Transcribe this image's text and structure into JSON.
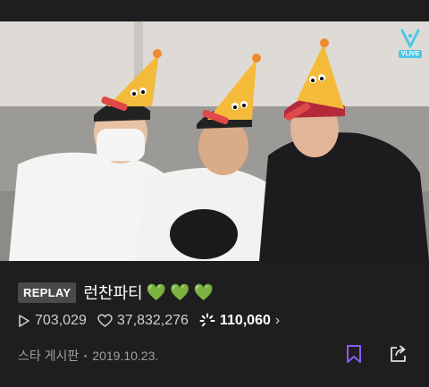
{
  "video": {
    "badge_label": "VLIVE"
  },
  "post": {
    "badge": "REPLAY",
    "title": "런찬파티",
    "hearts": [
      "💚",
      "💚",
      "💚"
    ]
  },
  "stats": {
    "plays": "703,029",
    "likes": "37,832,276",
    "chemi": "110,060",
    "chevron": "›"
  },
  "meta": {
    "board": "스타 게시판",
    "date": "2019.10.23."
  },
  "colors": {
    "accent_purple": "#8a5cf6",
    "heart_green": "#66cc33",
    "vlive_blue": "#4ec7e6"
  },
  "icons": [
    "play-icon",
    "heart-outline-icon",
    "chemi-icon",
    "bookmark-icon",
    "share-icon",
    "vlive-logo-icon"
  ]
}
